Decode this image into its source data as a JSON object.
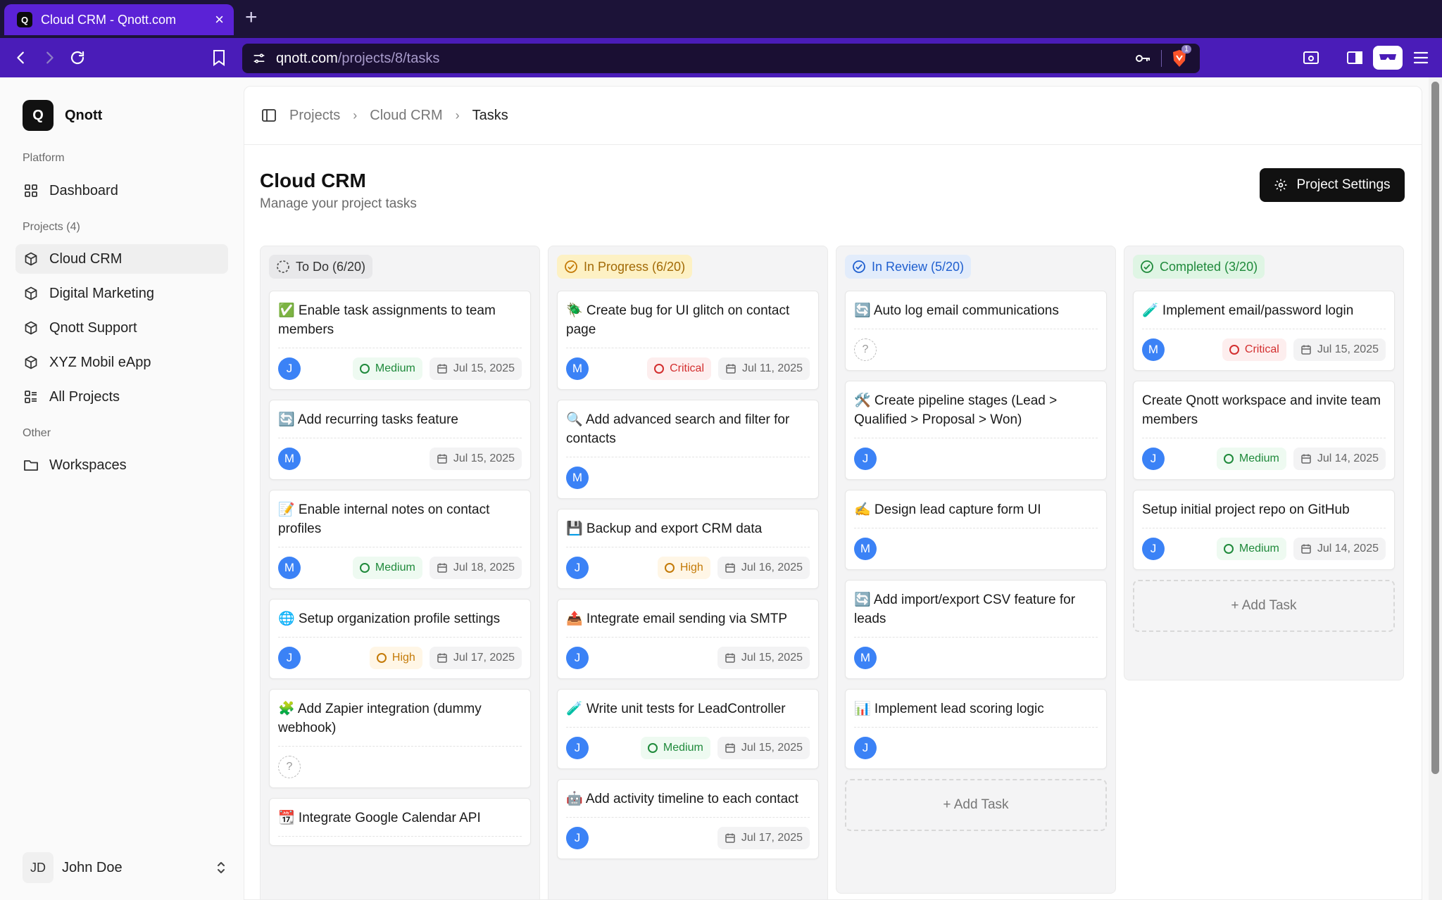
{
  "browser": {
    "tab_title": "Cloud CRM - Qnott.com",
    "tab_favicon": "Q",
    "tab_close": "×",
    "new_tab": "+",
    "url_host": "qnott.com",
    "url_path": "/projects/8/tasks",
    "shield_badge": "1"
  },
  "sidebar": {
    "logo_letter": "Q",
    "brand": "Qnott",
    "section_platform": "Platform",
    "dashboard": "Dashboard",
    "section_projects": "Projects (4)",
    "projects": [
      {
        "label": "Cloud CRM",
        "active": true
      },
      {
        "label": "Digital Marketing"
      },
      {
        "label": "Qnott Support"
      },
      {
        "label": "XYZ Mobil eApp"
      }
    ],
    "all_projects": "All Projects",
    "section_other": "Other",
    "workspaces": "Workspaces",
    "user_initials": "JD",
    "user_name": "John Doe"
  },
  "breadcrumb": [
    "Projects",
    "Cloud CRM",
    "Tasks"
  ],
  "page": {
    "title": "Cloud CRM",
    "subtitle": "Manage your project tasks",
    "settings_button": "Project Settings"
  },
  "columns": [
    {
      "label": "To Do (6/20)",
      "cards": [
        {
          "title": "✅ Enable task assignments to team members",
          "assignee": "J",
          "priority": "Medium",
          "date": "Jul 15, 2025"
        },
        {
          "title": "🔄 Add recurring tasks feature",
          "assignee": "M",
          "priority": "",
          "date": "Jul 15, 2025"
        },
        {
          "title": "📝 Enable internal notes on contact profiles",
          "assignee": "M",
          "priority": "Medium",
          "date": "Jul 18, 2025"
        },
        {
          "title": "🌐 Setup organization profile settings",
          "assignee": "J",
          "priority": "High",
          "date": "Jul 17, 2025"
        },
        {
          "title": "🧩 Add Zapier integration (dummy webhook)",
          "assignee": "?",
          "priority": "",
          "date": ""
        },
        {
          "title": "📆 Integrate Google Calendar API",
          "assignee": "",
          "priority": "",
          "date": ""
        }
      ]
    },
    {
      "label": "In Progress (6/20)",
      "cards": [
        {
          "title": "🪲 Create bug for UI glitch on contact page",
          "assignee": "M",
          "priority": "Critical",
          "date": "Jul 11, 2025"
        },
        {
          "title": "🔍 Add advanced search and filter for contacts",
          "assignee": "M",
          "priority": "",
          "date": ""
        },
        {
          "title": "💾 Backup and export CRM data",
          "assignee": "J",
          "priority": "High",
          "date": "Jul 16, 2025"
        },
        {
          "title": "📤 Integrate email sending via SMTP",
          "assignee": "J",
          "priority": "",
          "date": "Jul 15, 2025"
        },
        {
          "title": "🧪 Write unit tests for LeadController",
          "assignee": "J",
          "priority": "Medium",
          "date": "Jul 15, 2025"
        },
        {
          "title": "🤖 Add activity timeline to each contact",
          "assignee": "J",
          "priority": "",
          "date": "Jul 17, 2025"
        }
      ]
    },
    {
      "label": "In Review (5/20)",
      "cards": [
        {
          "title": "🔄 Auto log email communications",
          "assignee": "?",
          "priority": "",
          "date": ""
        },
        {
          "title": "🛠️ Create pipeline stages (Lead > Qualified > Proposal > Won)",
          "assignee": "J",
          "priority": "",
          "date": ""
        },
        {
          "title": "✍️ Design lead capture form UI",
          "assignee": "M",
          "priority": "",
          "date": ""
        },
        {
          "title": "🔄 Add import/export CSV feature for leads",
          "assignee": "M",
          "priority": "",
          "date": ""
        },
        {
          "title": "📊 Implement lead scoring logic",
          "assignee": "J",
          "priority": "",
          "date": ""
        }
      ],
      "add_task": "+ Add Task"
    },
    {
      "label": "Completed (3/20)",
      "cards": [
        {
          "title": "🧪 Implement email/password login",
          "assignee": "M",
          "priority": "Critical",
          "date": "Jul 15, 2025"
        },
        {
          "title": "Create Qnott workspace and invite team members",
          "assignee": "J",
          "priority": "Medium",
          "date": "Jul 14, 2025"
        },
        {
          "title": "Setup initial project repo on GitHub",
          "assignee": "J",
          "priority": "Medium",
          "date": "Jul 14, 2025"
        }
      ],
      "add_task": "+ Add Task"
    }
  ]
}
